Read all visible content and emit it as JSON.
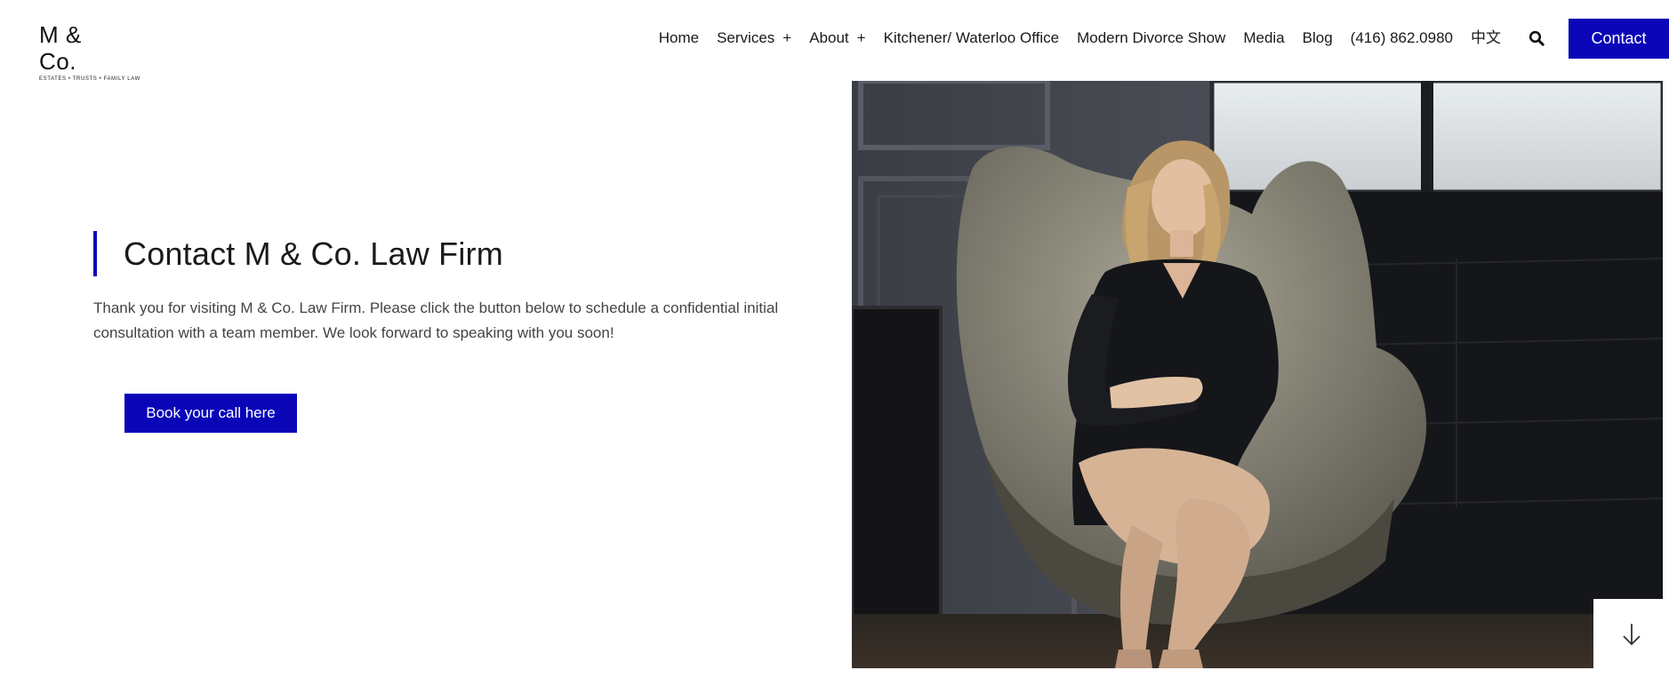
{
  "logo": {
    "name": "M & Co.",
    "tagline": "ESTATES • TRUSTS • FAMILY LAW"
  },
  "nav": {
    "items": [
      {
        "label": "Home",
        "has_submenu": false
      },
      {
        "label": "Services",
        "has_submenu": true
      },
      {
        "label": "About",
        "has_submenu": true
      },
      {
        "label": "Kitchener/ Waterloo Office",
        "has_submenu": false
      },
      {
        "label": "Modern Divorce Show",
        "has_submenu": false
      },
      {
        "label": "Media",
        "has_submenu": false
      },
      {
        "label": "Blog",
        "has_submenu": false
      },
      {
        "label": "(416) 862.0980",
        "has_submenu": false
      },
      {
        "label": "中文",
        "has_submenu": false
      }
    ],
    "submenu_glyph": "+",
    "search_icon": "search-icon",
    "contact_label": "Contact"
  },
  "main": {
    "title": "Contact M & Co. Law Firm",
    "intro": "Thank you for visiting  M & Co. Law Firm. Please click the button below to schedule a confidential initial consultation with a team member. We look forward to speaking with you soon!",
    "cta_label": "Book your call here"
  },
  "hero": {
    "icon": "portrait-photo"
  },
  "scroll_down": {
    "icon": "arrow-down-icon"
  },
  "colors": {
    "accent": "#0a06b8",
    "text": "#1a1a1a",
    "muted": "#444444",
    "background": "#ffffff"
  }
}
